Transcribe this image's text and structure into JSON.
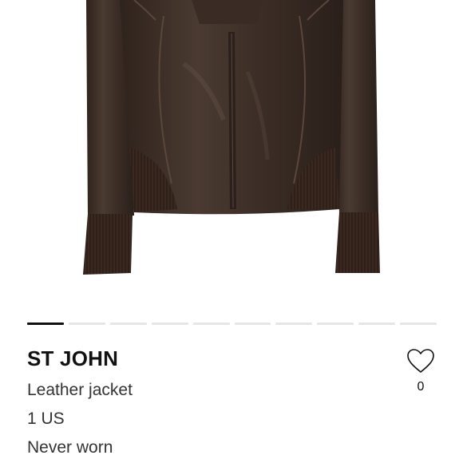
{
  "product": {
    "brand": "ST JOHN",
    "title": "Leather jacket",
    "size": "1 US",
    "condition": "Never worn"
  },
  "gallery": {
    "image": "brown-leather-jacket-photo",
    "total_images": 10,
    "active_index": 0
  },
  "like": {
    "icon": "heart-outline-icon",
    "count": "0"
  },
  "colors": {
    "leather": "#3f3028",
    "knit": "#3a2720",
    "active_indicator": "#111111",
    "inactive_indicator": "#e6e6e6"
  }
}
